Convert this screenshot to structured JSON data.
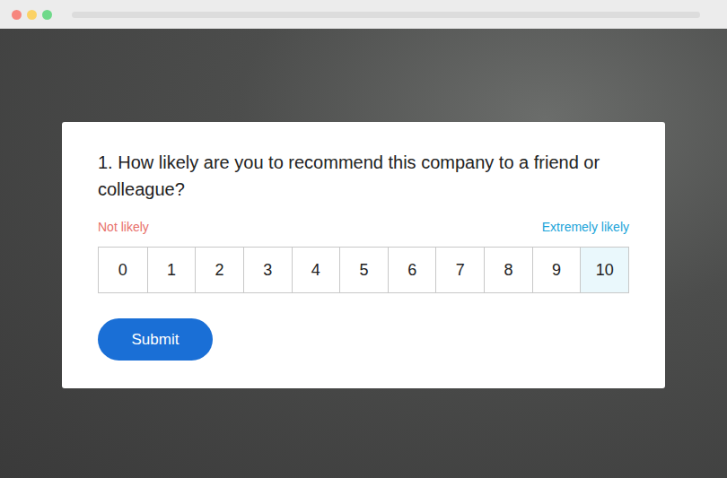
{
  "survey": {
    "question": "1. How likely are you to recommend this company to a friend or colleague?",
    "low_label": "Not likely",
    "high_label": "Extremely likely",
    "options": [
      {
        "label": "0",
        "selected": false
      },
      {
        "label": "1",
        "selected": false
      },
      {
        "label": "2",
        "selected": false
      },
      {
        "label": "3",
        "selected": false
      },
      {
        "label": "4",
        "selected": false
      },
      {
        "label": "5",
        "selected": false
      },
      {
        "label": "6",
        "selected": false
      },
      {
        "label": "7",
        "selected": false
      },
      {
        "label": "8",
        "selected": false
      },
      {
        "label": "9",
        "selected": false
      },
      {
        "label": "10",
        "selected": true
      }
    ]
  },
  "buttons": [
    "Submit"
  ]
}
